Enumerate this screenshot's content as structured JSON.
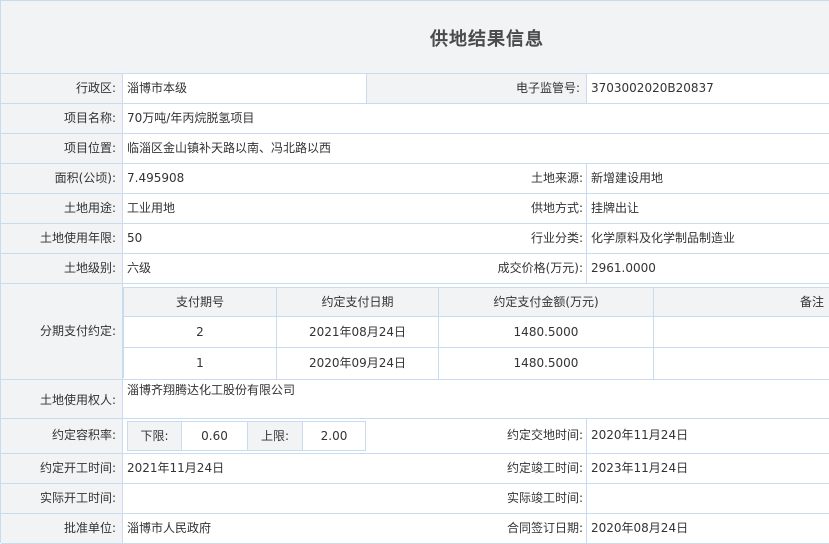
{
  "title": "供地结果信息",
  "fields": {
    "district_label": "行政区:",
    "district_value": "淄博市本级",
    "supervision_no_label": "电子监管号:",
    "supervision_no_value": "3703002020B20837",
    "project_name_label": "项目名称:",
    "project_name_value": "70万吨/年丙烷脱氢项目",
    "location_label": "项目位置:",
    "location_value": "临淄区金山镇补天路以南、冯北路以西",
    "area_label": "面积(公顷):",
    "area_value": "7.495908",
    "land_source_label": "土地来源:",
    "land_source_value": "新增建设用地",
    "land_use_label": "土地用途:",
    "land_use_value": "工业用地",
    "supply_method_label": "供地方式:",
    "supply_method_value": "挂牌出让",
    "use_years_label": "土地使用年限:",
    "use_years_value": "50",
    "industry_label": "行业分类:",
    "industry_value": "化学原料及化学制品制造业",
    "land_level_label": "土地级别:",
    "land_level_value": "六级",
    "price_label": "成交价格(万元):",
    "price_value": "2961.0000",
    "installment_label": "分期支付约定:",
    "land_user_label": "土地使用权人:",
    "land_user_value": "淄博齐翔腾达化工股份有限公司",
    "far_label": "约定容积率:",
    "far_lower_label": "下限:",
    "far_lower_value": "0.60",
    "far_upper_label": "上限:",
    "far_upper_value": "2.00",
    "handover_label": "约定交地时间:",
    "handover_value": "2020年11月24日",
    "start_label": "约定开工时间:",
    "start_value": "2021年11月24日",
    "finish_label": "约定竣工时间:",
    "finish_value": "2023年11月24日",
    "actual_start_label": "实际开工时间:",
    "actual_start_value": "",
    "actual_finish_label": "实际竣工时间:",
    "actual_finish_value": "",
    "approver_label": "批准单位:",
    "approver_value": "淄博市人民政府",
    "contract_date_label": "合同签订日期:",
    "contract_date_value": "2020年08月24日"
  },
  "installments": {
    "headers": [
      "支付期号",
      "约定支付日期",
      "约定支付金额(万元)",
      "备注"
    ],
    "rows": [
      [
        "2",
        "2021年08月24日",
        "1480.5000",
        ""
      ],
      [
        "1",
        "2020年09月24日",
        "1480.5000",
        ""
      ]
    ]
  },
  "colors": {
    "border": "#c9dcef",
    "label_bg": "#f2f3f5"
  }
}
